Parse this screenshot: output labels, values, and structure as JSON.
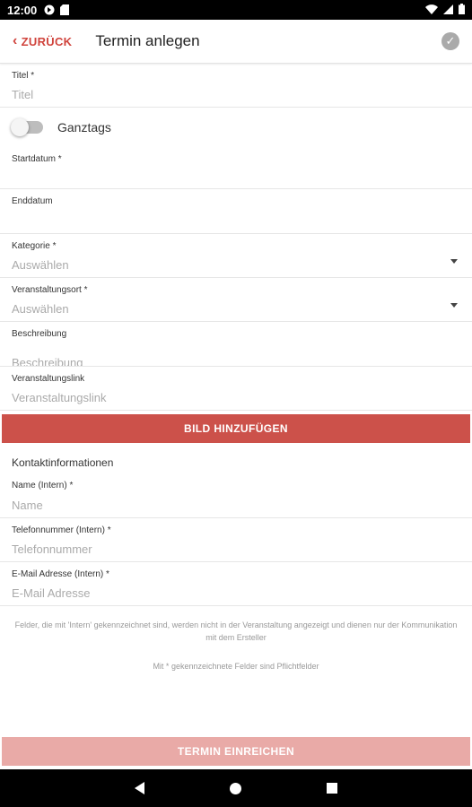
{
  "status": {
    "time": "12:00"
  },
  "appbar": {
    "back_label": "ZURÜCK",
    "title": "Termin anlegen"
  },
  "fields": {
    "title": {
      "label": "Titel *",
      "placeholder": "Titel"
    },
    "allday": {
      "label": "Ganztags",
      "checked": false
    },
    "start": {
      "label": "Startdatum *"
    },
    "end": {
      "label": "Enddatum"
    },
    "category": {
      "label": "Kategorie *",
      "placeholder": "Auswählen"
    },
    "venue": {
      "label": "Veranstaltungsort *",
      "placeholder": "Auswählen"
    },
    "description": {
      "label": "Beschreibung",
      "placeholder": "Beschreibung"
    },
    "link": {
      "label": "Veranstaltungslink",
      "placeholder": "Veranstaltungslink"
    }
  },
  "add_image_label": "BILD HINZUFÜGEN",
  "contact": {
    "section_title": "Kontaktinformationen",
    "name": {
      "label": "Name (Intern) *",
      "placeholder": "Name"
    },
    "phone": {
      "label": "Telefonnummer (Intern) *",
      "placeholder": "Telefonnummer"
    },
    "email": {
      "label": "E-Mail Adresse (Intern) *",
      "placeholder": "E-Mail Adresse"
    }
  },
  "notes": {
    "intern": "Felder, die mit 'Intern' gekennzeichnet sind, werden nicht in der Veranstaltung angezeigt und dienen nur der Kommunikation mit dem Ersteller",
    "required": "Mit * gekennzeichnete Felder sind Pflichtfelder"
  },
  "submit_label": "TERMIN EINREICHEN",
  "colors": {
    "accent": "#cc514a",
    "submit_disabled": "#e9aaa7",
    "back_text": "#d0443d"
  }
}
